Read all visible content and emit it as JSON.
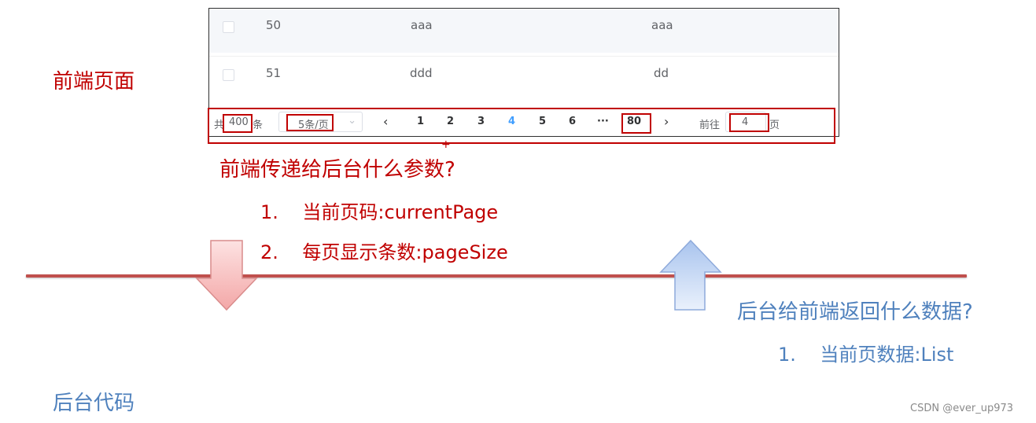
{
  "labels": {
    "frontend_page": "前端页面",
    "backend_code": "后台代码"
  },
  "table": {
    "rows": [
      {
        "id": "50",
        "col2": "aaa",
        "col3": "aaa"
      },
      {
        "id": "51",
        "col2": "ddd",
        "col3": "dd"
      }
    ]
  },
  "pagination": {
    "total_prefix": "共",
    "total": "400",
    "total_suffix": "条",
    "page_size": "5条/页",
    "pages": [
      "1",
      "2",
      "3",
      "4",
      "5",
      "6"
    ],
    "active_page": "4",
    "ellipsis": "···",
    "last_page": "80",
    "goto_label": "前往",
    "goto_value": "4",
    "goto_suffix": "页",
    "prev_icon": "chevron-left-icon",
    "next_icon": "chevron-right-icon"
  },
  "question_frontend": {
    "title": "前端传递给后台什么参数?",
    "items": [
      "1.    当前页码:currentPage",
      "2.    每页显示条数:pageSize"
    ]
  },
  "question_backend": {
    "title": "后台给前端返回什么数据?",
    "items": [
      "1.    当前页数据:List"
    ]
  },
  "arrows": {
    "down": "down-arrow-icon",
    "up": "up-arrow-icon"
  },
  "colors": {
    "red": "#c00000",
    "blue": "#4f81bd",
    "line": "#c0504d",
    "pager_active": "#409eff"
  },
  "watermark": "CSDN @ever_up973",
  "cursor_mark": "+"
}
